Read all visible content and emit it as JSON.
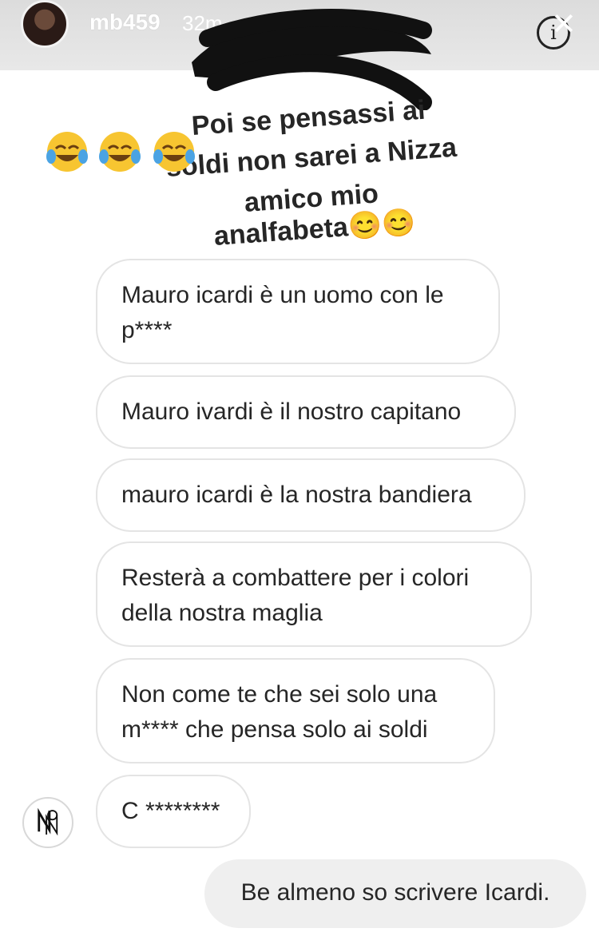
{
  "header": {
    "username": "mb459",
    "time_ago": "32m",
    "info_glyph": "i",
    "close_glyph": "✕"
  },
  "story": {
    "lines": [
      "Poi se pensassi ai",
      "soldi non sarei a Nizza",
      "amico mio",
      "analfabeta😊😊"
    ],
    "emojis": [
      "face-with-tears-of-joy",
      "face-with-tears-of-joy",
      "face-with-tears-of-joy"
    ],
    "text_color": "#262626"
  },
  "messages": [
    {
      "text": "Mauro icardi è un uomo con le p****"
    },
    {
      "text": "Mauro ivardi è il nostro capitano"
    },
    {
      "text": "mauro icardi è la nostra bandiera"
    },
    {
      "text": "Resterà a combattere per i colori della nostra maglia"
    },
    {
      "text": "Non come te che sei solo una m**** che pensa solo ai soldi"
    },
    {
      "text": "C ********"
    }
  ],
  "reply": {
    "text": "Be almeno so scrivere Icardi."
  },
  "colors": {
    "bubble_border": "#e4e4e4",
    "reply_bg": "#efefef",
    "text": "#262626"
  }
}
